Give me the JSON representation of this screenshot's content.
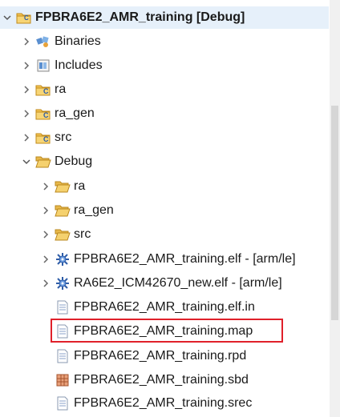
{
  "tree": {
    "project": {
      "label": "FPBRA6E2_AMR_training [Debug]"
    },
    "binaries": {
      "label": "Binaries"
    },
    "includes": {
      "label": "Includes"
    },
    "ra": {
      "label": "ra"
    },
    "ra_gen": {
      "label": "ra_gen"
    },
    "src": {
      "label": "src"
    },
    "debug": {
      "label": "Debug"
    },
    "debug_ra": {
      "label": "ra"
    },
    "debug_ra_gen": {
      "label": "ra_gen"
    },
    "debug_src": {
      "label": "src"
    },
    "elf_training": {
      "label": "FPBRA6E2_AMR_training.elf - [arm/le]"
    },
    "elf_icm": {
      "label": "RA6E2_ICM42670_new.elf - [arm/le]"
    },
    "file_elf_in": {
      "label": "FPBRA6E2_AMR_training.elf.in"
    },
    "file_map": {
      "label": "FPBRA6E2_AMR_training.map"
    },
    "file_rpd": {
      "label": "FPBRA6E2_AMR_training.rpd"
    },
    "file_sbd": {
      "label": "FPBRA6E2_AMR_training.sbd"
    },
    "file_srec": {
      "label": "FPBRA6E2_AMR_training.srec"
    }
  },
  "colors": {
    "folder": "#e8b84a",
    "highlight": "#e0202a",
    "selection": "#e6f0fa"
  }
}
